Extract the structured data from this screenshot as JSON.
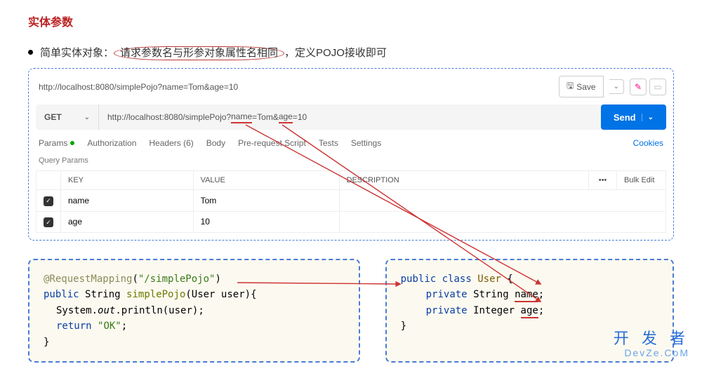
{
  "title": "实体参数",
  "subtitle": {
    "prefix": "简单实体对象：",
    "circled": "请求参数名与形参对象属性名相同",
    "suffix": "，定义POJO接收即可"
  },
  "postman": {
    "breadcrumb": "http://localhost:8080/simplePojo?name=Tom&age=10",
    "save": "Save",
    "method": "GET",
    "url_prefix": "http://localhost:8080/simplePojo?",
    "url_p1k": "name",
    "url_p1v": "=Tom&",
    "url_p2k": "age",
    "url_p2v": "=10",
    "send": "Send",
    "tabs": {
      "params": "Params",
      "auth": "Authorization",
      "headers": "Headers (6)",
      "body": "Body",
      "prereq": "Pre-request Script",
      "tests": "Tests",
      "settings": "Settings",
      "cookies": "Cookies"
    },
    "qp_label": "Query Params",
    "cols": {
      "key": "KEY",
      "value": "VALUE",
      "desc": "DESCRIPTION",
      "bulk": "Bulk Edit"
    },
    "rows": [
      {
        "key": "name",
        "value": "Tom"
      },
      {
        "key": "age",
        "value": "10"
      }
    ]
  },
  "code_left": {
    "ann": "@RequestMapping",
    "ann_path": "\"/simplePojo\"",
    "kw_public": "public",
    "ret": "String",
    "fn": "simplePojo",
    "param_type": "User",
    "param_name": "user",
    "line2a": "System.",
    "line2b": "out",
    "line2c": ".println(user);",
    "kw_return": "return",
    "ret_val": "\"OK\""
  },
  "code_right": {
    "kw_public": "public",
    "kw_class": "class",
    "cls": "User",
    "kw_private": "private",
    "t1": "String",
    "f1": "name",
    "t2": "Integer",
    "f2": "age"
  },
  "watermark": {
    "main": "开 发 者",
    "sub": "DevZe.CoM"
  }
}
